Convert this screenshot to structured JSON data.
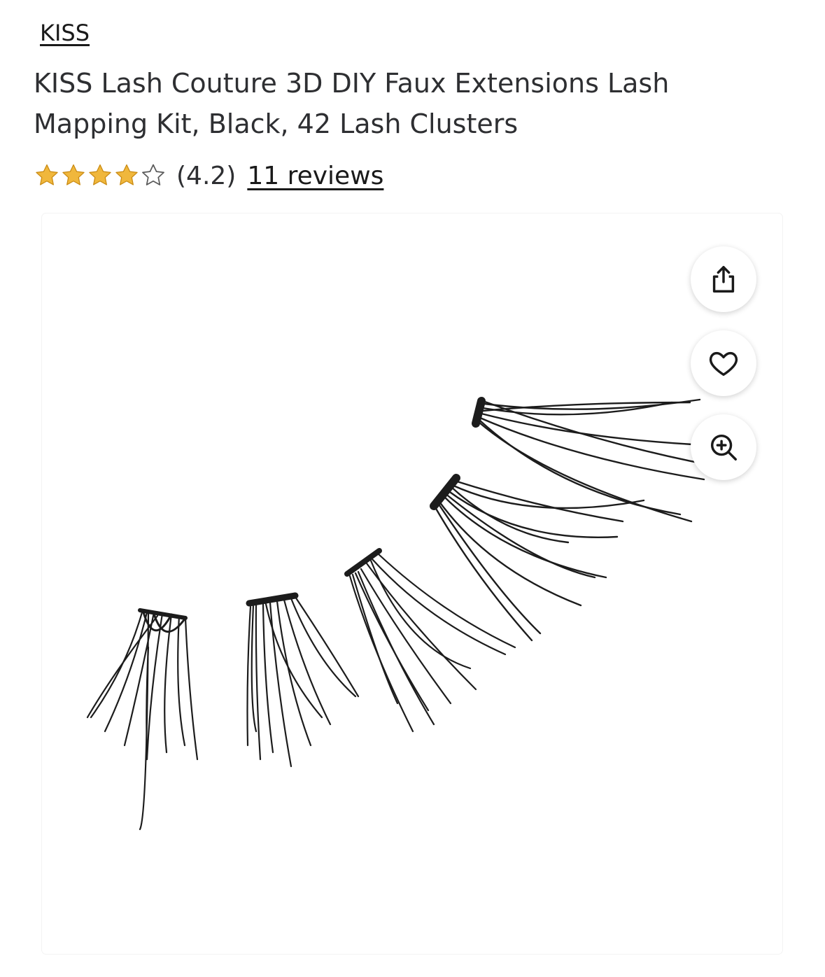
{
  "brand": {
    "label": "KISS"
  },
  "product": {
    "title": "KISS Lash Couture 3D DIY Faux Extensions Lash Mapping Kit, Black, 42 Lash Clusters"
  },
  "rating": {
    "stars_filled": 4,
    "stars_total": 5,
    "value_text": "(4.2)",
    "reviews_text": "11 reviews",
    "star_color": "#f0b73c"
  },
  "image_actions": [
    {
      "icon": "share-icon"
    },
    {
      "icon": "heart-icon"
    },
    {
      "icon": "zoom-in-icon"
    }
  ],
  "product_image": {
    "subject": "lash clusters"
  }
}
